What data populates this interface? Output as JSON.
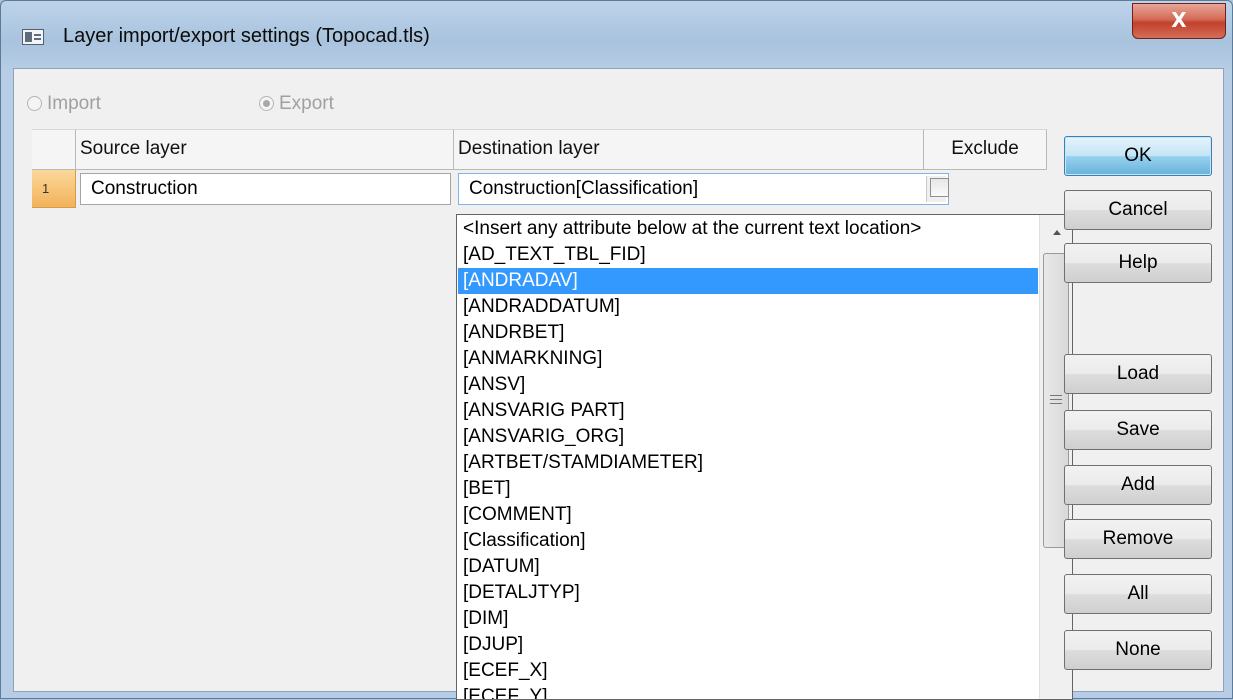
{
  "window": {
    "title": "Layer import/export settings (Topocad.tls)",
    "close_label": "X"
  },
  "mode": {
    "import_label": "Import",
    "export_label": "Export",
    "selected": "Export"
  },
  "grid": {
    "columns": [
      "Source layer",
      "Destination layer",
      "Exclude"
    ],
    "rows": [
      {
        "number": "1",
        "source": "Construction",
        "destination": "Construction[Classification]",
        "exclude": false
      }
    ]
  },
  "dropdown": {
    "items": [
      "<Insert any attribute below at the current text location>",
      "[AD_TEXT_TBL_FID]",
      "[ANDRADAV]",
      "[ANDRADDATUM]",
      "[ANDRBET]",
      "[ANMARKNING]",
      "[ANSV]",
      "[ANSVARIG PART]",
      "[ANSVARIG_ORG]",
      "[ARTBET/STAMDIAMETER]",
      "[BET]",
      "[COMMENT]",
      "[Classification]",
      "[DATUM]",
      "[DETALJTYP]",
      "[DIM]",
      "[DJUP]",
      "[ECEF_X]",
      "[ECEF_Y]"
    ],
    "selected_index": 2
  },
  "buttons": {
    "ok": "OK",
    "cancel": "Cancel",
    "help": "Help",
    "load": "Load",
    "save": "Save",
    "add": "Add",
    "remove": "Remove",
    "all": "All",
    "none": "None"
  }
}
